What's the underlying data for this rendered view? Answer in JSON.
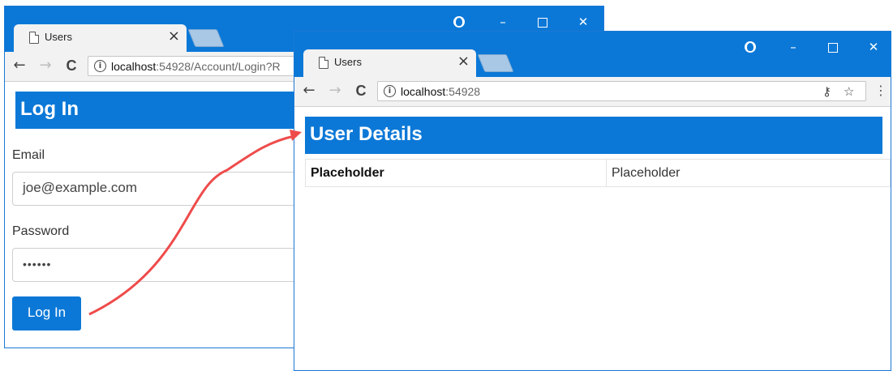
{
  "login_window": {
    "tab_title": "Users",
    "tab_close": "×",
    "url_host": "localhost",
    "url_rest": ":54928/Account/Login?R",
    "heading": "Log In",
    "email_label": "Email",
    "email_value": "joe@example.com",
    "password_label": "Password",
    "password_value": "••••••",
    "login_button": "Log In"
  },
  "details_window": {
    "tab_title": "Users",
    "tab_close": "×",
    "url_host": "localhost",
    "url_rest": ":54928",
    "heading": "User Details",
    "rows": [
      {
        "key": "Placeholder",
        "value": "Placeholder"
      }
    ]
  },
  "window_controls": {
    "minimize": "–",
    "close": "✕"
  },
  "toolbar_glyphs": {
    "back": "←",
    "forward": "→",
    "reload": "C",
    "info": "i",
    "key": "⚷",
    "star": "☆",
    "menu": "⋮"
  },
  "colors": {
    "accent": "#0b78d7",
    "arrow": "#ef4b4b"
  },
  "icons": [
    "page-icon",
    "profile-icon",
    "minimize-icon",
    "maximize-icon",
    "close-icon",
    "back-icon",
    "forward-icon",
    "reload-icon",
    "info-icon",
    "key-icon",
    "star-icon",
    "menu-icon",
    "arrow-connector"
  ]
}
